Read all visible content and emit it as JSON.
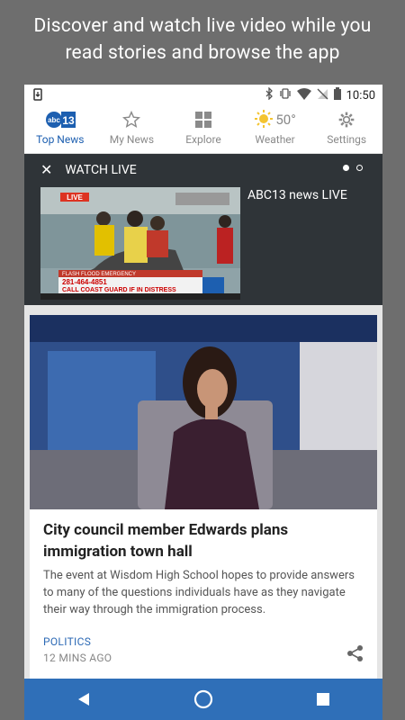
{
  "promo": {
    "line1": "Discover and watch live video while you",
    "line2": "read stories and browse the app"
  },
  "status": {
    "time": "10:50"
  },
  "tabs": [
    {
      "label": "Top News",
      "icon": "abc13-logo"
    },
    {
      "label": "My News",
      "icon": "star-icon"
    },
    {
      "label": "Explore",
      "icon": "grid-icon"
    },
    {
      "label": "Weather",
      "icon": "sun-icon",
      "temp": "50°"
    },
    {
      "label": "Settings",
      "icon": "gear-icon"
    }
  ],
  "live": {
    "header": "WATCH LIVE",
    "title": "ABC13 news LIVE",
    "thumb_badge": "LIVE",
    "ticker": "281-464-4851",
    "ticker2": "CALL COAST GUARD IF IN DISTRESS",
    "ticker_top": "FLASH FLOOD EMERGENCY"
  },
  "article": {
    "headline": "City council member Edwards plans immigration town hall",
    "summary": "The event at Wisdom High School hopes to provide answers to many of the questions individuals have as they navigate their way through the immigration process.",
    "category": "POLITICS",
    "time": "12 MINS AGO"
  },
  "colors": {
    "accent": "#1d5fb0",
    "nav": "#2f6fb8",
    "live_bg": "#2f3438"
  }
}
